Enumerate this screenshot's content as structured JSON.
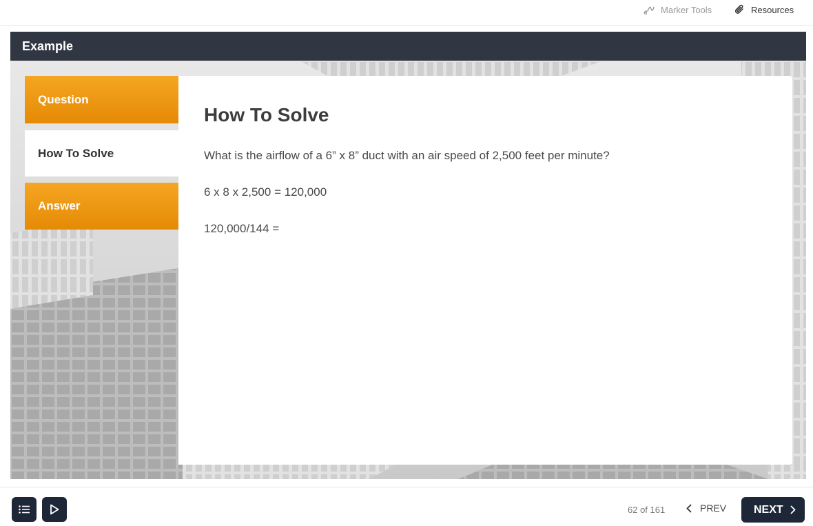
{
  "toolbar": {
    "marker_tools_label": "Marker Tools",
    "resources_label": "Resources"
  },
  "header": {
    "title": "Example"
  },
  "tabs": [
    {
      "label": "Question",
      "active": false
    },
    {
      "label": "How To Solve",
      "active": true
    },
    {
      "label": "Answer",
      "active": false
    }
  ],
  "content": {
    "title": "How To Solve",
    "lines": [
      "What is the airflow of a  6” x 8” duct with an air speed of 2,500 feet per minute?",
      "6 x 8 x 2,500 = 120,000",
      "120,000/144 ="
    ]
  },
  "footer": {
    "menu_icon": "list-icon",
    "play_icon": "play-icon",
    "page_count": "62 of 161",
    "prev_label": "PREV",
    "next_label": "NEXT"
  },
  "colors": {
    "header_bg": "#303642",
    "tab_orange": "#f19a12",
    "button_dark": "#1e2738"
  }
}
